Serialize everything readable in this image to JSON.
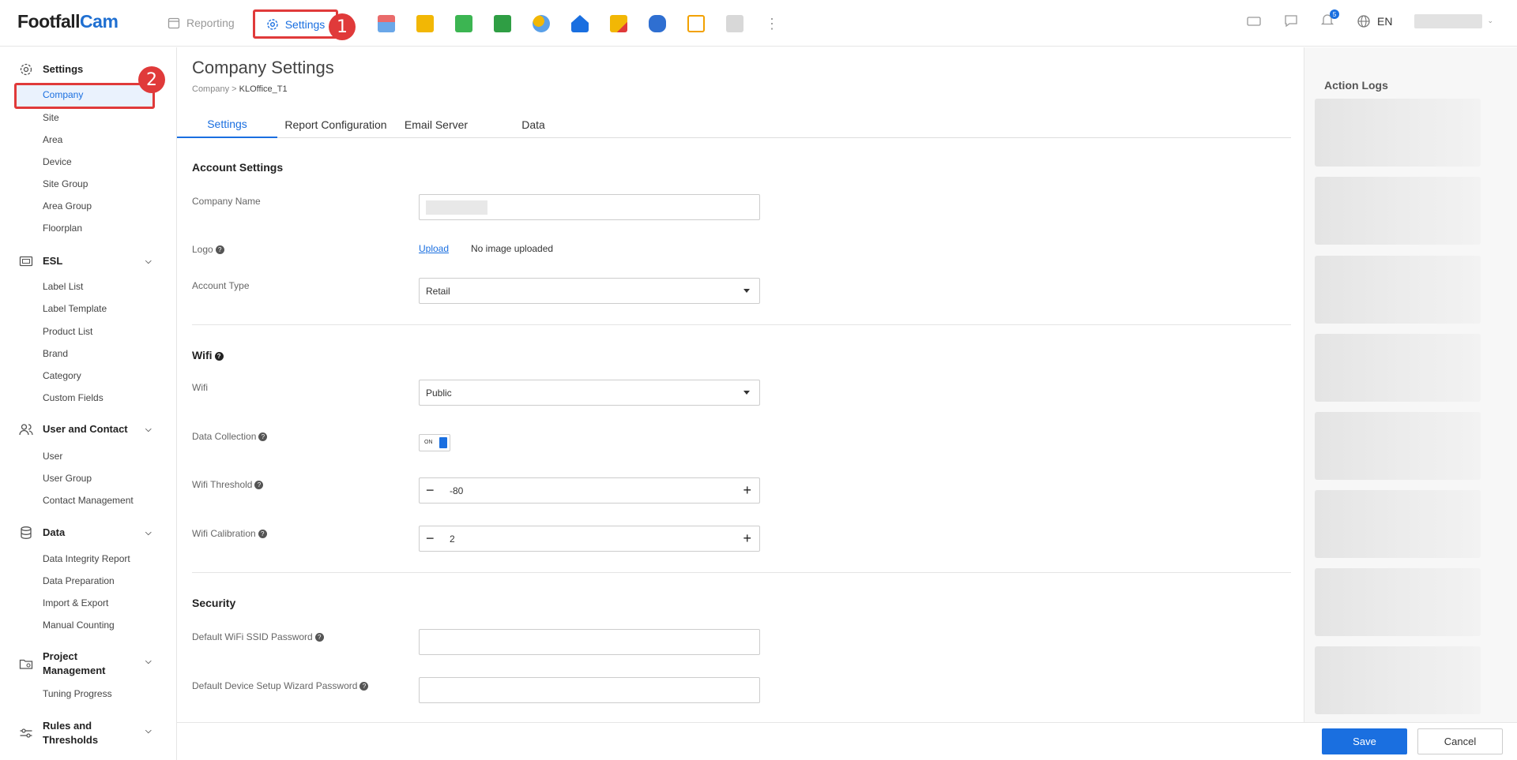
{
  "app": {
    "logo_part1": "Footfall",
    "logo_part2": "Cam"
  },
  "topnav": {
    "reporting": "Reporting",
    "settings": "Settings",
    "step1": "1",
    "language": "EN",
    "notification_count": "5",
    "more": "⋮"
  },
  "sidebar": {
    "step2": "2",
    "settings": {
      "label": "Settings",
      "items": [
        "Company",
        "Site",
        "Area",
        "Device",
        "Site Group",
        "Area Group",
        "Floorplan"
      ]
    },
    "esl": {
      "label": "ESL",
      "items": [
        "Label List",
        "Label Template",
        "Product List",
        "Brand",
        "Category",
        "Custom Fields"
      ]
    },
    "user_contact": {
      "label": "User and Contact",
      "items": [
        "User",
        "User Group",
        "Contact Management"
      ]
    },
    "data": {
      "label": "Data",
      "items": [
        "Data Integrity Report",
        "Data Preparation",
        "Import & Export",
        "Manual Counting"
      ]
    },
    "project": {
      "label_line1": "Project",
      "label_line2": "Management",
      "items": [
        "Tuning Progress"
      ]
    },
    "rules": {
      "label_line1": "Rules and",
      "label_line2": "Thresholds"
    }
  },
  "main": {
    "title": "Company Settings",
    "breadcrumb_root": "Company",
    "breadcrumb_sep": ">",
    "breadcrumb_current": "KLOffice_T1",
    "tabs": [
      "Settings",
      "Report Configuration",
      "Email Server",
      "Data"
    ],
    "account": {
      "heading": "Account Settings",
      "company_name_label": "Company Name",
      "logo_label": "Logo",
      "upload": "Upload",
      "no_image": "No image uploaded",
      "account_type_label": "Account Type",
      "account_type_value": "Retail"
    },
    "wifi": {
      "heading": "Wifi",
      "wifi_label": "Wifi",
      "wifi_value": "Public",
      "data_collection_label": "Data Collection",
      "toggle_text": "ON",
      "threshold_label": "Wifi Threshold",
      "threshold_value": "-80",
      "calibration_label": "Wifi Calibration",
      "calibration_value": "2"
    },
    "security": {
      "heading": "Security",
      "ssid_password_label": "Default WiFi SSID Password",
      "wizard_password_label": "Default Device Setup Wizard Password"
    }
  },
  "right_panel": {
    "title": "Action Logs"
  },
  "footer": {
    "save": "Save",
    "cancel": "Cancel"
  },
  "colors": {
    "accent": "#1a6fe0",
    "highlight": "#e03a3a"
  }
}
